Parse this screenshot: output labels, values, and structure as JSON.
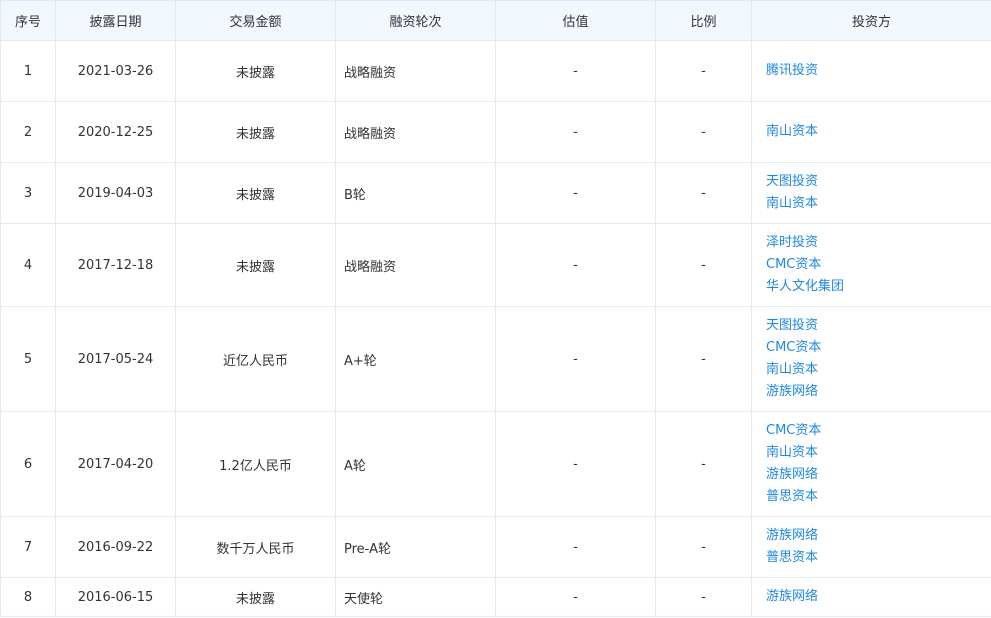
{
  "headers": [
    "序号",
    "披露日期",
    "交易金额",
    "融资轮次",
    "估值",
    "比例",
    "投资方"
  ],
  "rows": [
    {
      "no": "1",
      "date": "2021-03-26",
      "amount": "未披露",
      "round": "战略融资",
      "valuation": "-",
      "ratio": "-",
      "investors": [
        "腾讯投资"
      ]
    },
    {
      "no": "2",
      "date": "2020-12-25",
      "amount": "未披露",
      "round": "战略融资",
      "valuation": "-",
      "ratio": "-",
      "investors": [
        "南山资本"
      ]
    },
    {
      "no": "3",
      "date": "2019-04-03",
      "amount": "未披露",
      "round": "B轮",
      "valuation": "-",
      "ratio": "-",
      "investors": [
        "天图投资",
        "南山资本"
      ]
    },
    {
      "no": "4",
      "date": "2017-12-18",
      "amount": "未披露",
      "round": "战略融资",
      "valuation": "-",
      "ratio": "-",
      "investors": [
        "泽时投资",
        "CMC资本",
        "华人文化集团"
      ]
    },
    {
      "no": "5",
      "date": "2017-05-24",
      "amount": "近亿人民币",
      "round": "A+轮",
      "valuation": "-",
      "ratio": "-",
      "investors": [
        "天图投资",
        "CMC资本",
        "南山资本",
        "游族网络"
      ]
    },
    {
      "no": "6",
      "date": "2017-04-20",
      "amount": "1.2亿人民币",
      "round": "A轮",
      "valuation": "-",
      "ratio": "-",
      "investors": [
        "CMC资本",
        "南山资本",
        "游族网络",
        "普思资本"
      ]
    },
    {
      "no": "7",
      "date": "2016-09-22",
      "amount": "数千万人民币",
      "round": "Pre-A轮",
      "valuation": "-",
      "ratio": "-",
      "investors": [
        "游族网络",
        "普思资本"
      ]
    },
    {
      "no": "8",
      "date": "2016-06-15",
      "amount": "未披露",
      "round": "天使轮",
      "valuation": "-",
      "ratio": "-",
      "investors": [
        "游族网络"
      ]
    }
  ]
}
